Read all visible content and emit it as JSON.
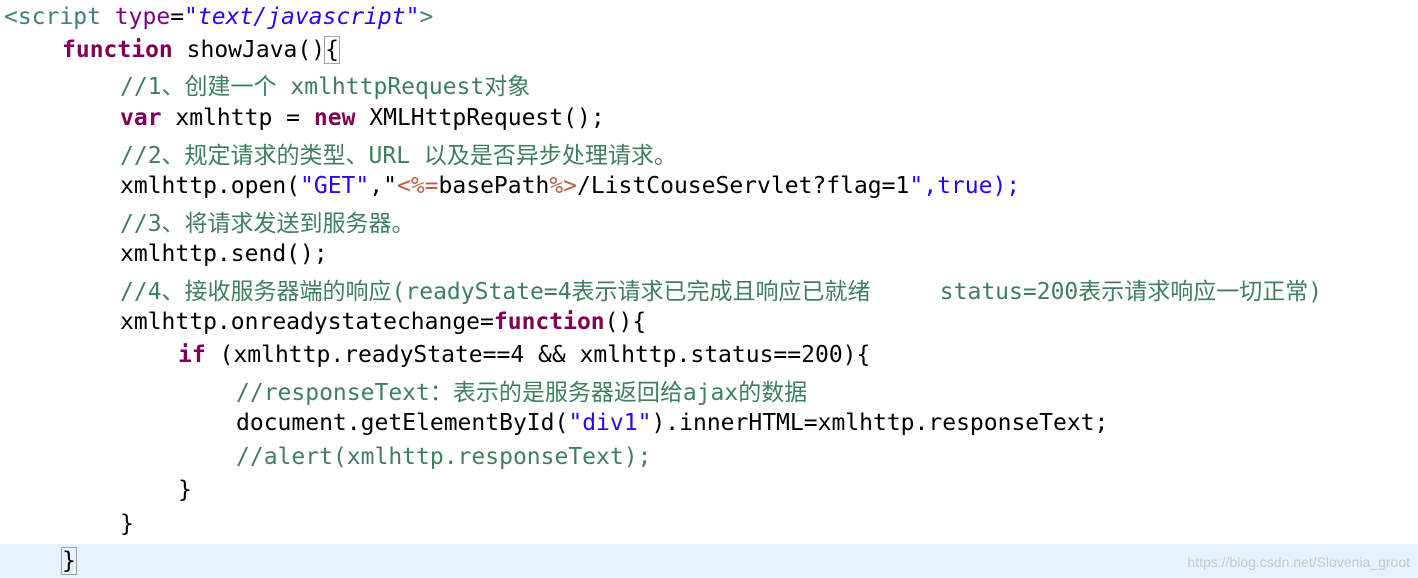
{
  "code": {
    "l1_open": "<script",
    "l1_attr": "type",
    "l1_eq": "=",
    "l1_val": "\"text/javascript\"",
    "l1_close": ">",
    "l2_kw": "function",
    "l2_rest": " showJava()",
    "l2_brace": "{",
    "l3_comment": "//1、创建一个 xmlhttpRequest对象",
    "l4_kw1": "var",
    "l4_mid": " xmlhttp = ",
    "l4_kw2": "new",
    "l4_rest": " XMLHttpRequest();",
    "l5_comment": "//2、规定请求的类型、URL 以及是否异步处理请求。",
    "l6_a": "xmlhttp.open(",
    "l6_get": "\"GET\"",
    "l6_comma": ",",
    "l6_q1": "\"",
    "l6_jsp_open": "<%=",
    "l6_base": "basePath",
    "l6_jsp_close": "%>",
    "l6_path": "/ListCouseServlet?flag=1",
    "l6_q2": "\"",
    "l6_tail": ",true);",
    "l7_comment": "//3、将请求发送到服务器。",
    "l8_text": "xmlhttp.send();",
    "l9_comment": "//4、接收服务器端的响应(readyState=4表示请求已完成且响应已就绪     status=200表示请求响应一切正常)",
    "l10_a": "xmlhttp.onreadystatechange=",
    "l10_kw": "function",
    "l10_b": "(){",
    "l11_kw": "if",
    "l11_rest": " (xmlhttp.readyState==4 && xmlhttp.status==200){",
    "l12_comment": "//responseText：表示的是服务器返回给ajax的数据",
    "l13_a": "document.getElementById(",
    "l13_str": "\"div1\"",
    "l13_b": ").innerHTML=xmlhttp.responseText;",
    "l14_comment": "//alert(xmlhttp.responseText);",
    "l15_text": "}",
    "l16_text": "}",
    "l17_text": "}"
  },
  "watermark": "https://blog.csdn.net/Slovenia_groot"
}
